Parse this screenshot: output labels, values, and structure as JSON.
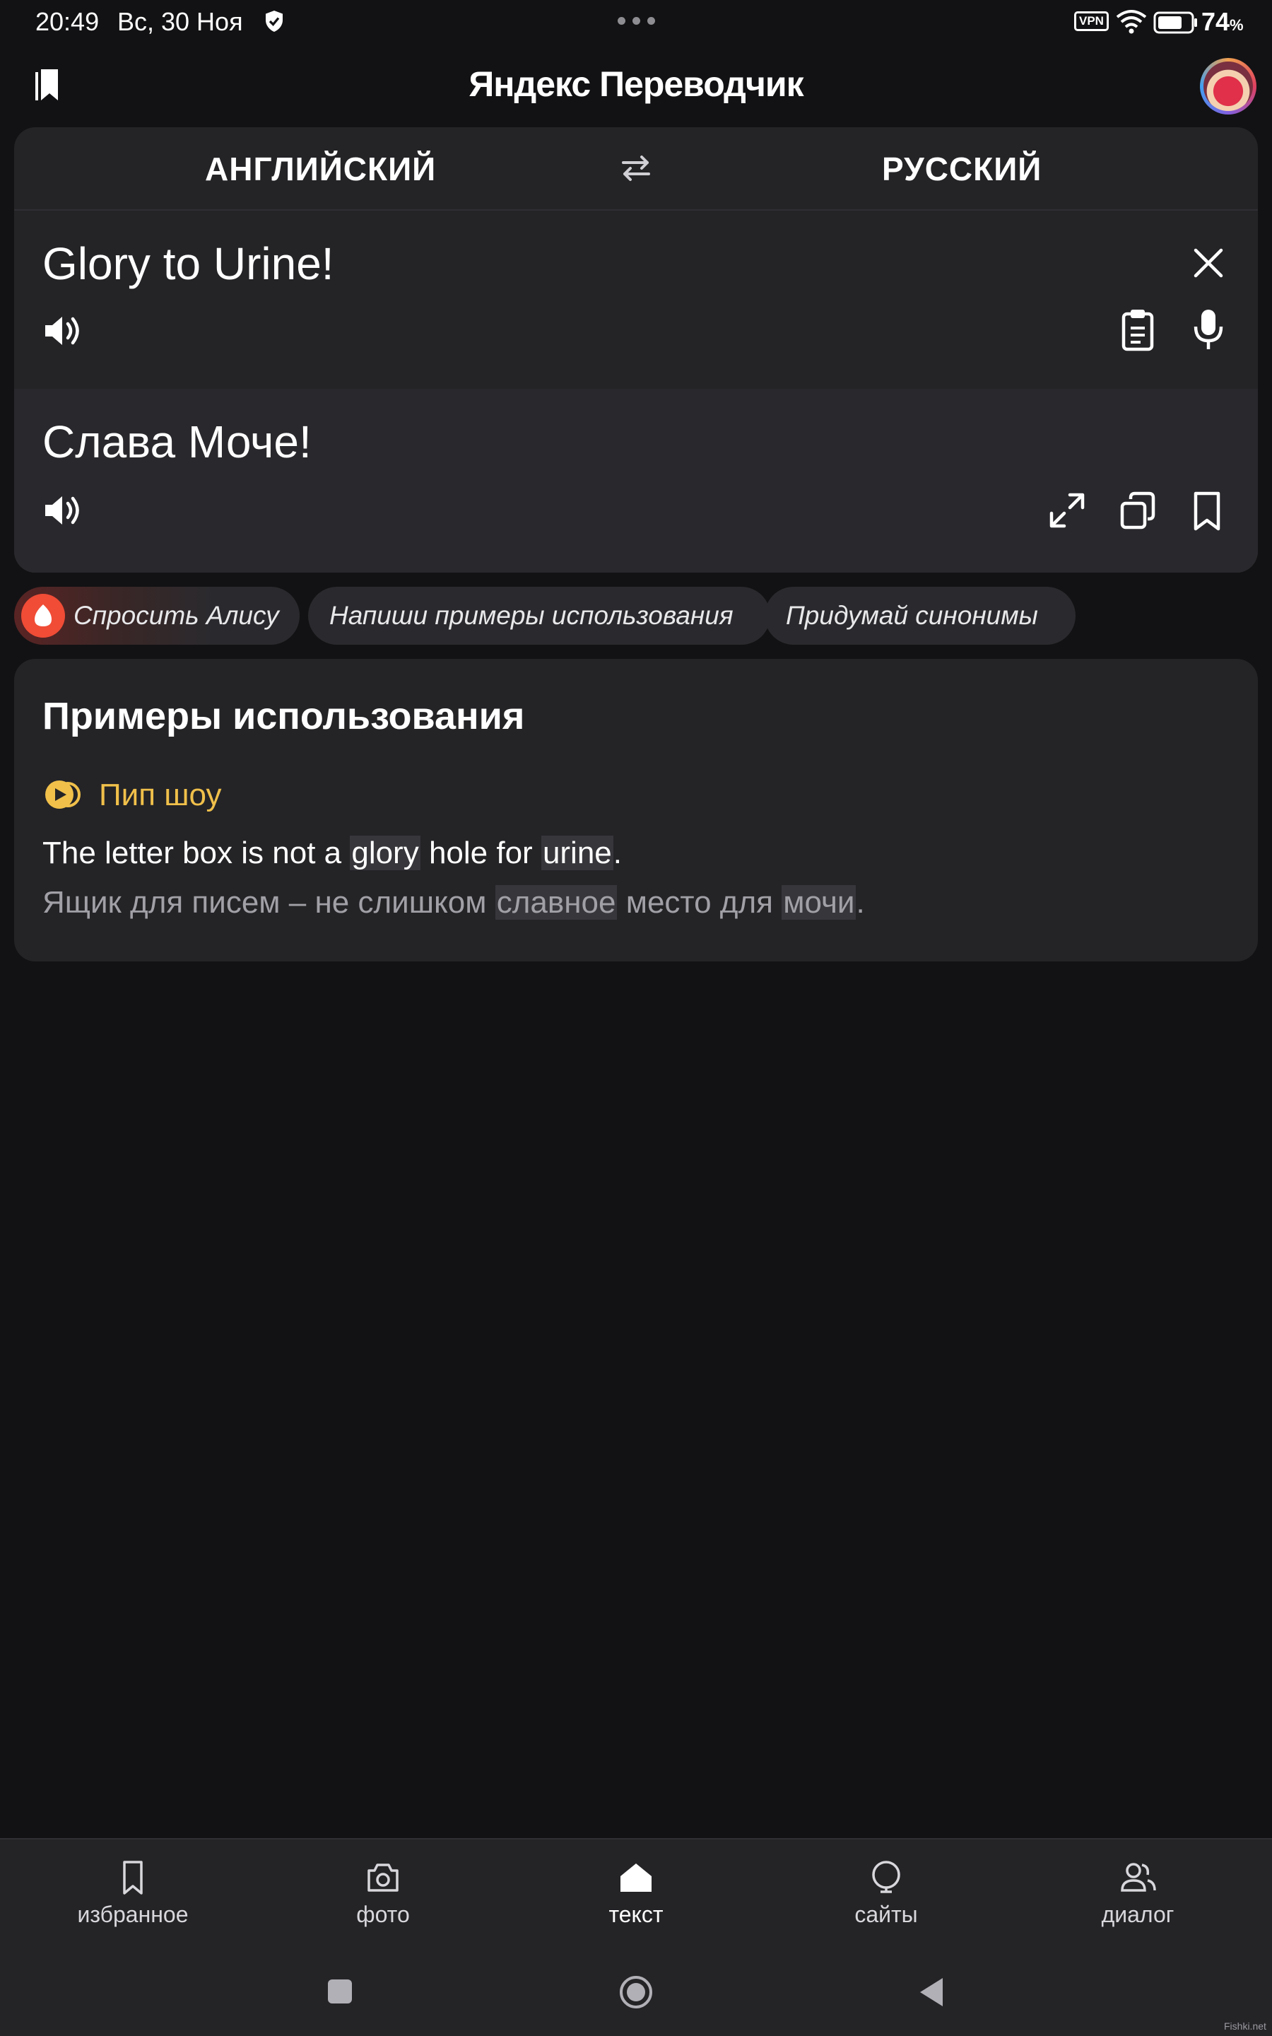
{
  "status_bar": {
    "time": "20:49",
    "date": "Вс, 30 Ноя",
    "vpn": "VPN",
    "battery_value": "74",
    "battery_unit": "%"
  },
  "header": {
    "title": "Яндекс Переводчик",
    "left_icon": "bookmarks-icon",
    "right_icon": "avatar"
  },
  "translator": {
    "source_lang": "АНГЛИЙСКИЙ",
    "target_lang": "РУССКИЙ",
    "source_text": "Glory to Urine!",
    "translation": "Слава Моче!"
  },
  "chips": [
    {
      "label": "Спросить Алису"
    },
    {
      "label": "Напиши примеры использования"
    },
    {
      "label": "Придумай синонимы"
    }
  ],
  "examples": {
    "title": "Примеры использования",
    "source": "Пип шоу",
    "sentence": {
      "p1": "The letter box is not a ",
      "h1": "glory",
      "p2": " hole for ",
      "h2": "urine",
      "p3": "."
    },
    "translation": {
      "p1": "Ящик для писем – не слишком ",
      "h1": "славное",
      "p2": " место для ",
      "h2": "мочи",
      "p3": "."
    }
  },
  "bottom_nav": [
    {
      "label": "избранное",
      "icon": "bookmark-icon"
    },
    {
      "label": "фото",
      "icon": "camera-icon"
    },
    {
      "label": "текст",
      "icon": "home-icon"
    },
    {
      "label": "сайты",
      "icon": "globe-icon"
    },
    {
      "label": "диалог",
      "icon": "people-icon"
    }
  ],
  "watermark": "Fishki.net",
  "colors": {
    "background": "#121214",
    "card": "#242427",
    "accent_source": "#f0c04a",
    "alice": "#f04c36"
  }
}
